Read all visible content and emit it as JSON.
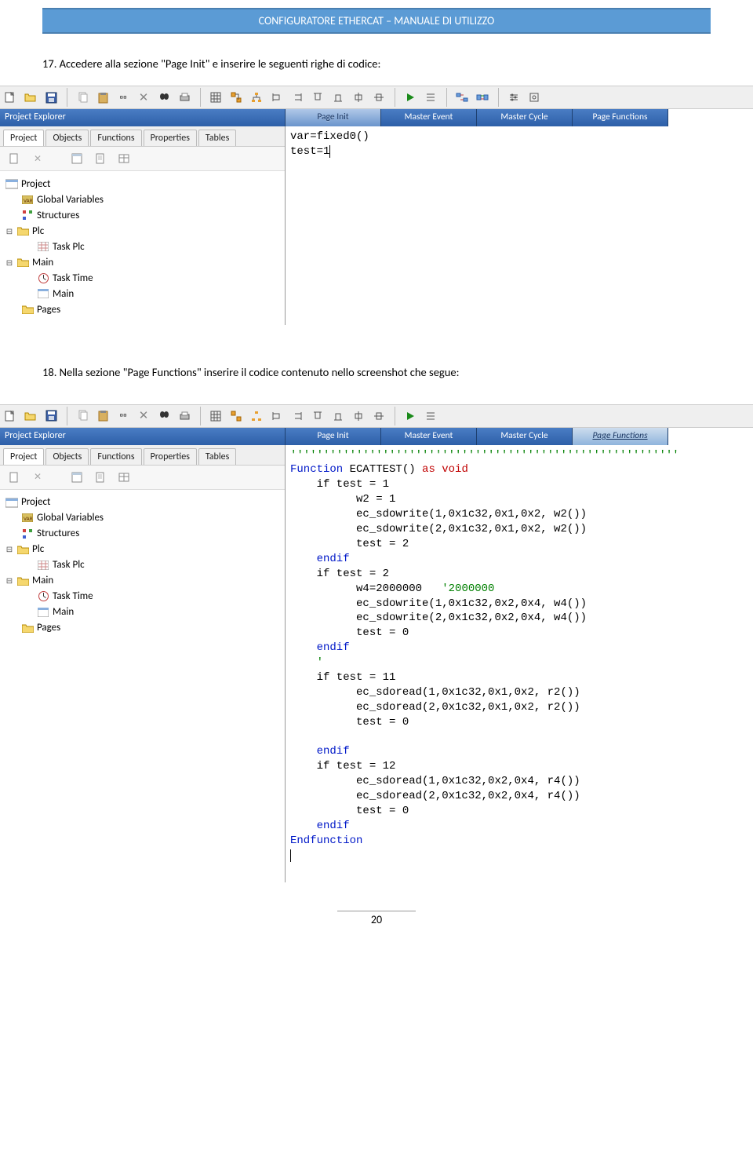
{
  "doc": {
    "header": "CONFIGURATORE ETHERCAT – MANUALE DI UTILIZZO",
    "step17": "17. Accedere alla sezione \"Page Init\" e inserire le seguenti righe di codice:",
    "step18": "18. Nella sezione \"Page Functions\" inserire il codice contenuto nello screenshot che segue:",
    "pagenum": "20"
  },
  "shot1": {
    "project_explorer_title": "Project Explorer",
    "proj_tabs": [
      "Project",
      "Objects",
      "Functions",
      "Properties",
      "Tables"
    ],
    "tree": {
      "root": "Project",
      "n1": "Global Variables",
      "n2": "Structures",
      "n3": "Plc",
      "n3a": "Task Plc",
      "n4": "Main",
      "n4a": "Task Time",
      "n4b": "Main",
      "n5": "Pages"
    },
    "editor_tabs": [
      "Page Init",
      "Master Event",
      "Master Cycle",
      "Page Functions"
    ],
    "code": "var=fixed0()\ntest=1"
  },
  "shot2": {
    "project_explorer_title": "Project Explorer",
    "proj_tabs": [
      "Project",
      "Objects",
      "Functions",
      "Properties",
      "Tables"
    ],
    "tree": {
      "root": "Project",
      "n1": "Global Variables",
      "n2": "Structures",
      "n3": "Plc",
      "n3a": "Task Plc",
      "n4": "Main",
      "n4a": "Task Time",
      "n4b": "Main",
      "n5": "Pages"
    },
    "editor_tabs": [
      "Page Init",
      "Master Event",
      "Master Cycle",
      "Page Functions"
    ],
    "code_lines": [
      {
        "t": "'''''''''''''''''''''''''''''''''''''''''''''''''''''''''''",
        "c": "kw-green"
      },
      {
        "pre": "Function ",
        "pre_c": "kw-blue",
        "mid": "ECATTEST() ",
        "post": "as void",
        "post_c": "kw-red"
      },
      {
        "t": "    if test = 1"
      },
      {
        "t": "          w2 = 1"
      },
      {
        "t": "          ec_sdowrite(1,0x1c32,0x1,0x2, w2())"
      },
      {
        "t": "          ec_sdowrite(2,0x1c32,0x1,0x2, w2())"
      },
      {
        "t": "          test = 2"
      },
      {
        "t": "    endif",
        "c": "kw-blue"
      },
      {
        "t": "    if test = 2"
      },
      {
        "pre": "          w4=2000000   ",
        "post": "'2000000",
        "post_c": "kw-green"
      },
      {
        "t": "          ec_sdowrite(1,0x1c32,0x2,0x4, w4())"
      },
      {
        "t": "          ec_sdowrite(2,0x1c32,0x2,0x4, w4())"
      },
      {
        "t": "          test = 0"
      },
      {
        "t": "    endif",
        "c": "kw-blue"
      },
      {
        "t": "    '",
        "c": "kw-green"
      },
      {
        "t": "    if test = 11"
      },
      {
        "t": "          ec_sdoread(1,0x1c32,0x1,0x2, r2())"
      },
      {
        "t": "          ec_sdoread(2,0x1c32,0x1,0x2, r2())"
      },
      {
        "t": "          test = 0"
      },
      {
        "t": ""
      },
      {
        "t": "    endif",
        "c": "kw-blue"
      },
      {
        "t": "    if test = 12"
      },
      {
        "t": "          ec_sdoread(1,0x1c32,0x2,0x4, r4())"
      },
      {
        "t": "          ec_sdoread(2,0x1c32,0x2,0x4, r4())"
      },
      {
        "t": "          test = 0"
      },
      {
        "t": "    endif",
        "c": "kw-blue"
      },
      {
        "t": "Endfunction",
        "c": "kw-blue"
      }
    ]
  }
}
